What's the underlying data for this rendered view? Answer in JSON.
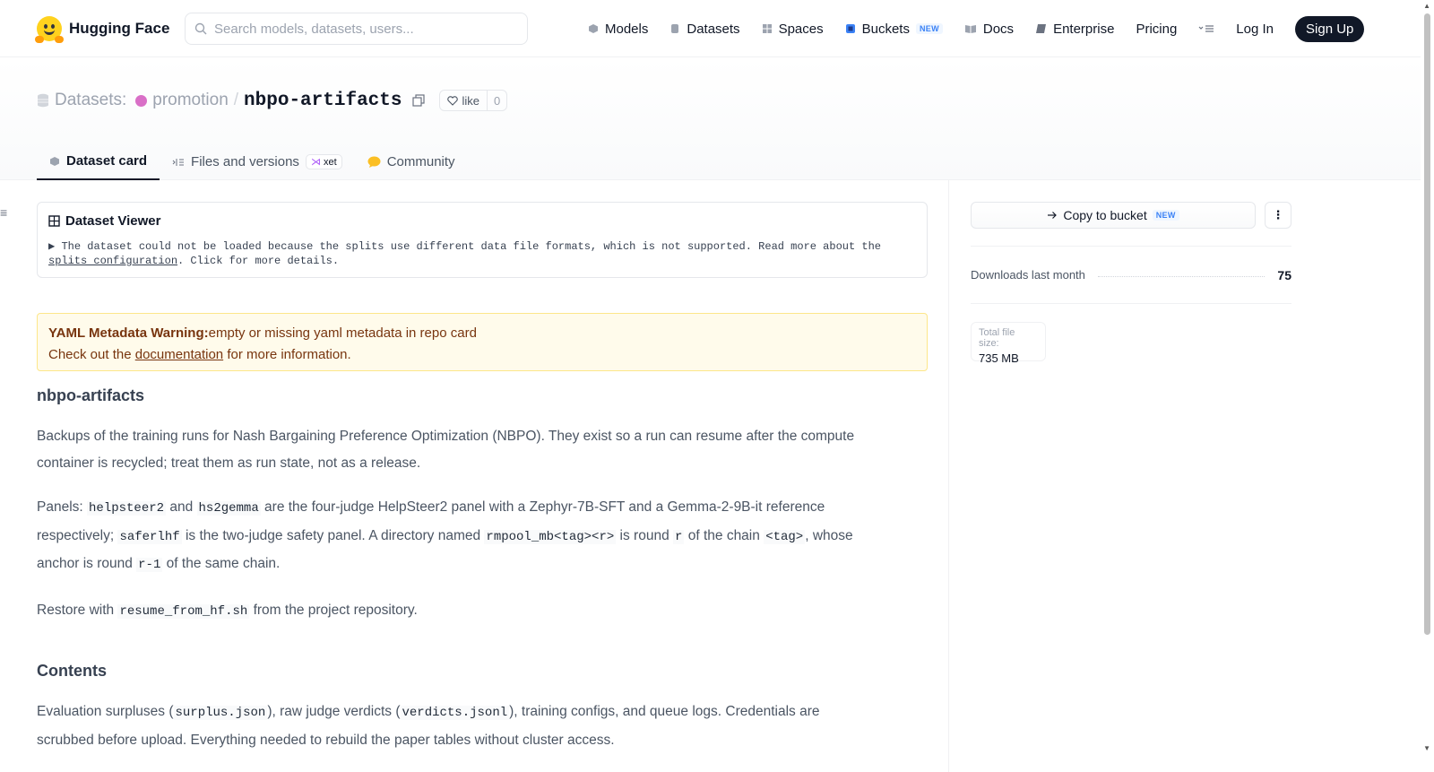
{
  "header": {
    "brand": "Hugging Face",
    "search_placeholder": "Search models, datasets, users...",
    "nav": {
      "models": "Models",
      "datasets": "Datasets",
      "spaces": "Spaces",
      "buckets": "Buckets",
      "buckets_badge": "NEW",
      "docs": "Docs",
      "enterprise": "Enterprise",
      "pricing": "Pricing",
      "login": "Log In",
      "signup": "Sign Up"
    }
  },
  "repo": {
    "type_label": "Datasets:",
    "owner": "promotion",
    "separator": "/",
    "name": "nbpo-artifacts",
    "like_label": "like",
    "like_count": "0"
  },
  "tabs": {
    "card": "Dataset card",
    "files": "Files and versions",
    "files_badge": "xet",
    "community": "Community"
  },
  "viewer": {
    "title": "Dataset Viewer",
    "message_pre": "The dataset could not be loaded because the splits use different data file formats, which is not supported. Read more about the",
    "message_link": "splits configuration",
    "message_post": ". Click for more details."
  },
  "warning": {
    "title": "YAML Metadata Warning:",
    "text": "empty or missing yaml metadata in repo card",
    "line2_pre": "Check out the",
    "line2_link": "documentation",
    "line2_post": "for more information."
  },
  "card": {
    "heading": "nbpo-artifacts",
    "p1": "Backups of the training runs for Nash Bargaining Preference Optimization (NBPO). They exist so a run can resume after the compute container is recycled; treat them as run state, not as a release.",
    "p2": {
      "t1": "Panels: ",
      "c1": "helpsteer2",
      "t2": " and ",
      "c2": "hs2gemma",
      "t3": " are the four-judge HelpSteer2 panel with a Zephyr-7B-SFT and a Gemma-2-9B-it reference respectively; ",
      "c3": "saferlhf",
      "t4": " is the two-judge safety panel. A directory named ",
      "c4": "rmpool_mb<tag><r>",
      "t5": " is round ",
      "c5": "r",
      "t6": " of the chain ",
      "c6": "<tag>",
      "t7": ", whose anchor is round ",
      "c7": "r-1",
      "t8": " of the same chain."
    },
    "p3": {
      "t1": "Restore with ",
      "c1": "resume_from_hf.sh",
      "t2": " from the project repository."
    },
    "contents_heading": "Contents",
    "p4": {
      "t1": "Evaluation surpluses (",
      "c1": "surplus.json",
      "t2": "), raw judge verdicts (",
      "c2": "verdicts.jsonl",
      "t3": "), training configs, and queue logs. Credentials are scrubbed before upload. Everything needed to rebuild the paper tables without cluster access."
    }
  },
  "sidebar": {
    "copy_label": "Copy to bucket",
    "copy_badge": "NEW",
    "downloads_label": "Downloads last month",
    "downloads_value": "75",
    "size_label": "Total file size:",
    "size_value": "735 MB"
  }
}
